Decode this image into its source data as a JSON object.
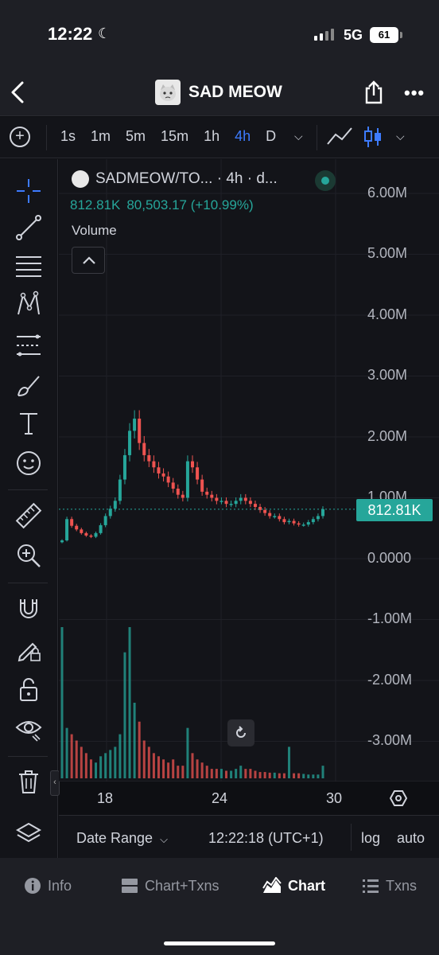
{
  "status": {
    "time": "12:22",
    "network": "5G",
    "battery": "61"
  },
  "header": {
    "title": "SAD MEOW"
  },
  "toolbar": {
    "intervals": [
      "1s",
      "1m",
      "5m",
      "15m",
      "1h",
      "4h",
      "D"
    ],
    "active_interval": "4h"
  },
  "legend": {
    "pair": "SADMEOW/TO... · 4h · d...",
    "price": "812.81K",
    "change": "80,503.17 (+10.99%)",
    "volume_label": "Volume"
  },
  "price_tag": "812.81K",
  "y_axis": [
    "6.00M",
    "5.00M",
    "4.00M",
    "3.00M",
    "2.00M",
    "1.00M",
    "0.0000",
    "-1.00M",
    "-2.00M",
    "-3.00M"
  ],
  "x_axis": [
    "18",
    "24",
    "30"
  ],
  "bottom_controls": {
    "date_range": "Date Range",
    "time": "12:22:18 (UTC+1)",
    "log": "log",
    "auto": "auto"
  },
  "tabs": [
    {
      "label": "Info",
      "icon": "info-icon"
    },
    {
      "label": "Chart+Txns",
      "icon": "split-view-icon"
    },
    {
      "label": "Chart",
      "icon": "chart-icon"
    },
    {
      "label": "Txns",
      "icon": "list-icon"
    }
  ],
  "active_tab": "Chart",
  "colors": {
    "up": "#26a69a",
    "down": "#ef5350",
    "accent": "#3d7bff",
    "background": "#131419"
  },
  "chart_data": {
    "type": "candlestick",
    "title": "SADMEOW/TO... · 4h · d...",
    "ylabel": "",
    "xlabel": "",
    "ylim": [
      -3500000,
      6300000
    ],
    "x_ticks": [
      "18",
      "24",
      "30"
    ],
    "grid": true,
    "last_price": 812810,
    "series": [
      {
        "name": "Price",
        "values": [
          300000,
          650000,
          540000,
          480000,
          420000,
          380000,
          360000,
          420000,
          550000,
          700000,
          820000,
          950000,
          1300000,
          1700000,
          2100000,
          2300000,
          1900000,
          1700000,
          1600000,
          1500000,
          1400000,
          1350000,
          1250000,
          1150000,
          1050000,
          1000000,
          1600000,
          1500000,
          1300000,
          1100000,
          1050000,
          1000000,
          950000,
          950000,
          900000,
          900000,
          950000,
          1000000,
          950000,
          900000,
          850000,
          800000,
          750000,
          700000,
          700000,
          650000,
          600000,
          620000,
          580000,
          560000,
          560000,
          600000,
          650000,
          700000,
          812810
        ]
      },
      {
        "name": "Volume",
        "values": [
          2400000,
          800000,
          700000,
          600000,
          500000,
          400000,
          300000,
          250000,
          350000,
          400000,
          450000,
          500000,
          700000,
          2000000,
          2400000,
          1200000,
          900000,
          600000,
          500000,
          400000,
          350000,
          300000,
          250000,
          300000,
          200000,
          200000,
          800000,
          400000,
          300000,
          250000,
          200000,
          150000,
          150000,
          150000,
          120000,
          120000,
          150000,
          200000,
          150000,
          150000,
          120000,
          100000,
          100000,
          90000,
          90000,
          80000,
          80000,
          500000,
          80000,
          80000,
          70000,
          60000,
          60000,
          60000,
          200000
        ]
      }
    ]
  }
}
